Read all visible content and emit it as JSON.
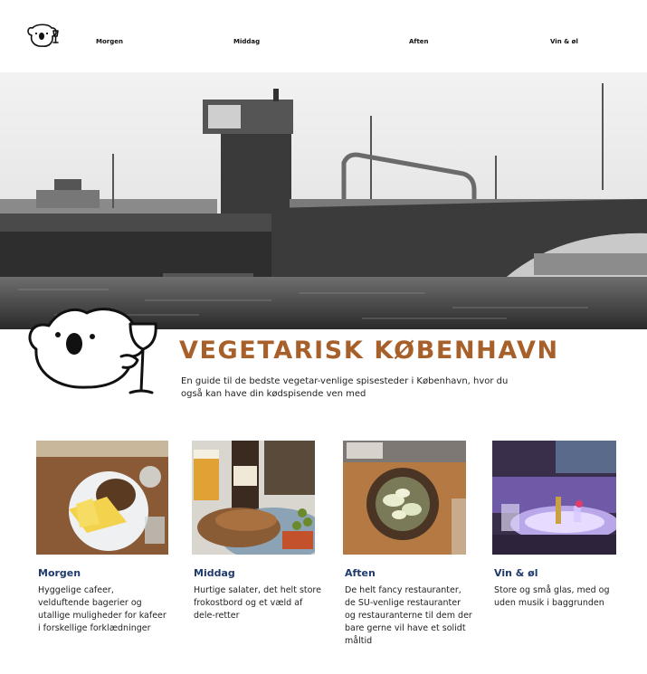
{
  "nav": {
    "logo_icon": "koala-wine-logo-icon",
    "items": [
      {
        "label": "Morgen"
      },
      {
        "label": "Middag"
      },
      {
        "label": "Aften"
      },
      {
        "label": "Vin & øl"
      }
    ]
  },
  "hero": {
    "image": "black-and-white photo of Copenhagen bridge and harbour"
  },
  "brand": {
    "mascot_icon": "koala-with-wine-glass-icon",
    "title": "VEGETARISK KØBENHAVN",
    "subtitle": "En guide til de bedste vegetar-venlige spisesteder i København, hvor du også kan have din kødspisende ven med",
    "title_color": "#a8602a"
  },
  "cards": [
    {
      "title": "Morgen",
      "text": "Hyggelige cafeer, velduftende bagerier og utallige muligheder for kafeer i forskellige forklædninger",
      "image": "breakfast-plate-photo"
    },
    {
      "title": "Middag",
      "text": "Hurtige salater, det helt store frokostbord og et væld af dele-retter",
      "image": "lunch-bread-beer-photo"
    },
    {
      "title": "Aften",
      "text": "De helt fancy restauranter, de SU-venlige restauranter og restauranterne til dem der bare gerne vil have et solidt måltid",
      "image": "dinner-bowl-photo"
    },
    {
      "title": "Vin & øl",
      "text": "Store og små glas, med og uden musik i baggrunden",
      "image": "wine-bar-photo"
    }
  ],
  "colors": {
    "heading": "#1f3a6b",
    "accent": "#a8602a"
  }
}
